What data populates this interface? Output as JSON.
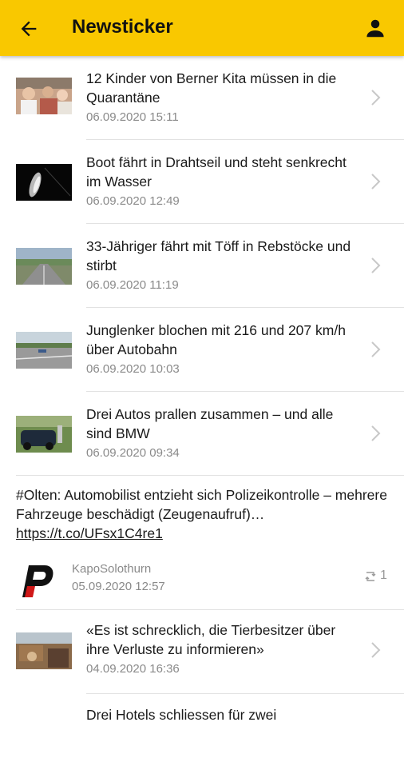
{
  "header": {
    "title": "Newsticker",
    "back_icon": "arrow-left-icon",
    "profile_icon": "person-icon",
    "background_color": "#f9c800"
  },
  "articles": [
    {
      "headline": "12 Kinder von Berner Kita müssen in die Quarantäne",
      "date": "06.09.2020 15:11",
      "thumb": "children-photo"
    },
    {
      "headline": "Boot fährt in Drahtseil und steht senkrecht im Wasser",
      "date": "06.09.2020 12:49",
      "thumb": "boat-photo"
    },
    {
      "headline": "33-Jähriger fährt mit Töff in Rebstöcke und stirbt",
      "date": "06.09.2020 11:19",
      "thumb": "road-photo"
    },
    {
      "headline": "Junglenker blochen mit 216 und 207 km/h über Autobahn",
      "date": "06.09.2020 10:03",
      "thumb": "highway-photo"
    },
    {
      "headline": "Drei Autos prallen zusammen – und alle sind BMW",
      "date": "06.09.2020 09:34",
      "thumb": "car-photo"
    }
  ],
  "tweet": {
    "text": "#Olten: Automobilist entzieht sich Polizeikontrolle – mehrere Fahrzeuge beschädigt (Zeugenaufruf)…",
    "link": "https://t.co/UFsx1C4re1",
    "handle": "KapoSolothurn",
    "date": "05.09.2020 12:57",
    "retweet_count": "1"
  },
  "articles_after": [
    {
      "headline": "«Es ist schrecklich, die Tierbesitzer über ihre Verluste zu informieren»",
      "date": "04.09.2020 16:36",
      "thumb": "animals-photo"
    },
    {
      "headline": "Drei Hotels schliessen für zwei",
      "date": "",
      "thumb": ""
    }
  ]
}
